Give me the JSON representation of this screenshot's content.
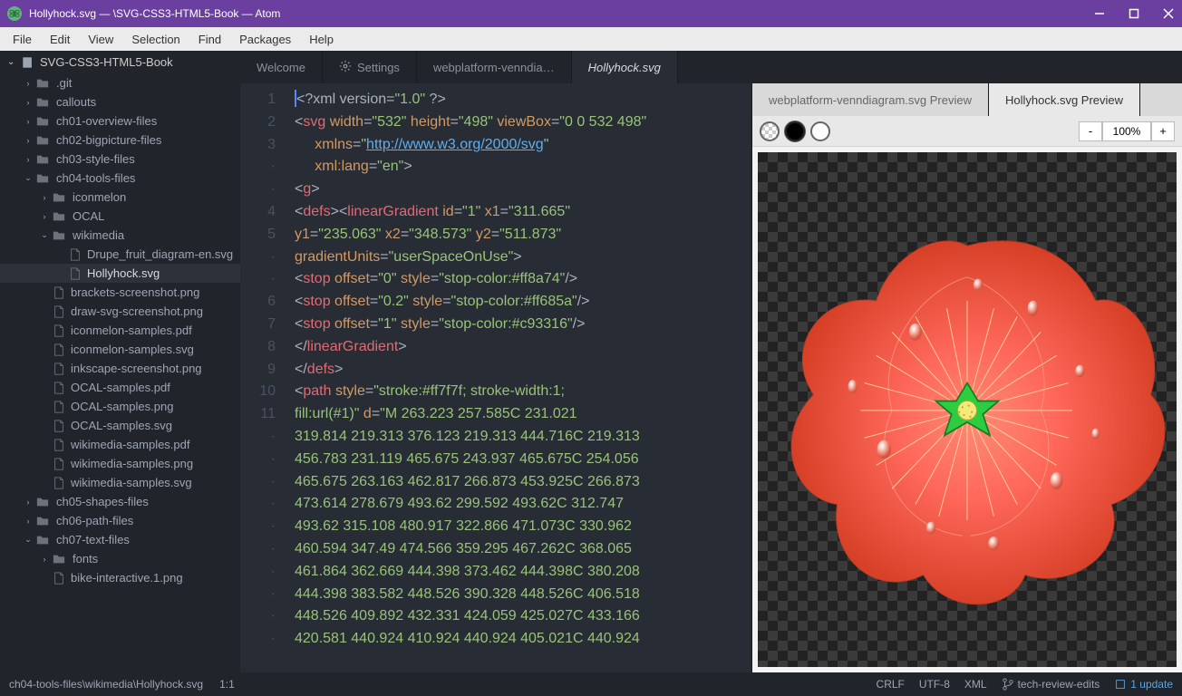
{
  "window": {
    "title": "Hollyhock.svg —                                                             \\SVG-CSS3-HTML5-Book — Atom"
  },
  "menu": [
    "File",
    "Edit",
    "View",
    "Selection",
    "Find",
    "Packages",
    "Help"
  ],
  "tree": {
    "root": "SVG-CSS3-HTML5-Book",
    "items": [
      {
        "indent": 1,
        "chev": "›",
        "type": "folder",
        "label": ".git"
      },
      {
        "indent": 1,
        "chev": "›",
        "type": "folder",
        "label": "callouts"
      },
      {
        "indent": 1,
        "chev": "›",
        "type": "folder",
        "label": "ch01-overview-files"
      },
      {
        "indent": 1,
        "chev": "›",
        "type": "folder",
        "label": "ch02-bigpicture-files"
      },
      {
        "indent": 1,
        "chev": "›",
        "type": "folder",
        "label": "ch03-style-files"
      },
      {
        "indent": 1,
        "chev": "⌄",
        "type": "folder",
        "label": "ch04-tools-files"
      },
      {
        "indent": 2,
        "chev": "›",
        "type": "folder",
        "label": "iconmelon"
      },
      {
        "indent": 2,
        "chev": "›",
        "type": "folder",
        "label": "OCAL"
      },
      {
        "indent": 2,
        "chev": "⌄",
        "type": "folder",
        "label": "wikimedia"
      },
      {
        "indent": 3,
        "chev": "",
        "type": "file",
        "label": "Drupe_fruit_diagram-en.svg"
      },
      {
        "indent": 3,
        "chev": "",
        "type": "file",
        "label": "Hollyhock.svg",
        "selected": true
      },
      {
        "indent": 2,
        "chev": "",
        "type": "file",
        "label": "brackets-screenshot.png"
      },
      {
        "indent": 2,
        "chev": "",
        "type": "file",
        "label": "draw-svg-screenshot.png"
      },
      {
        "indent": 2,
        "chev": "",
        "type": "file",
        "label": "iconmelon-samples.pdf"
      },
      {
        "indent": 2,
        "chev": "",
        "type": "file",
        "label": "iconmelon-samples.svg"
      },
      {
        "indent": 2,
        "chev": "",
        "type": "file",
        "label": "inkscape-screenshot.png"
      },
      {
        "indent": 2,
        "chev": "",
        "type": "file",
        "label": "OCAL-samples.pdf"
      },
      {
        "indent": 2,
        "chev": "",
        "type": "file",
        "label": "OCAL-samples.png"
      },
      {
        "indent": 2,
        "chev": "",
        "type": "file",
        "label": "OCAL-samples.svg"
      },
      {
        "indent": 2,
        "chev": "",
        "type": "file",
        "label": "wikimedia-samples.pdf"
      },
      {
        "indent": 2,
        "chev": "",
        "type": "file",
        "label": "wikimedia-samples.png"
      },
      {
        "indent": 2,
        "chev": "",
        "type": "file",
        "label": "wikimedia-samples.svg"
      },
      {
        "indent": 1,
        "chev": "›",
        "type": "folder",
        "label": "ch05-shapes-files"
      },
      {
        "indent": 1,
        "chev": "›",
        "type": "folder",
        "label": "ch06-path-files"
      },
      {
        "indent": 1,
        "chev": "⌄",
        "type": "folder",
        "label": "ch07-text-files"
      },
      {
        "indent": 2,
        "chev": "›",
        "type": "folder",
        "label": "fonts"
      },
      {
        "indent": 2,
        "chev": "",
        "type": "file",
        "label": "bike-interactive.1.png"
      }
    ]
  },
  "tabs": [
    {
      "label": "Welcome",
      "active": false,
      "icon": ""
    },
    {
      "label": "Settings",
      "active": false,
      "icon": "gear"
    },
    {
      "label": "webplatform-venndia…",
      "active": false,
      "icon": ""
    },
    {
      "label": "Hollyhock.svg",
      "active": true,
      "italic": true,
      "icon": ""
    },
    {
      "label": "webplatform-venndiagram.svg Preview",
      "active": false,
      "icon": "",
      "pane": "right"
    },
    {
      "label": "Hollyhock.svg Preview",
      "active": false,
      "preview_active": true,
      "icon": "",
      "pane": "right"
    }
  ],
  "gutter": [
    "1",
    "2",
    "3",
    "·",
    "·",
    "4",
    "5",
    "·",
    "·",
    "6",
    "7",
    "8",
    "9",
    "10",
    "11",
    "·",
    "·",
    "·",
    "·",
    "·",
    "·",
    "·",
    "·",
    "·",
    "·"
  ],
  "code_lines": [
    [
      {
        "c": "tok-punc",
        "t": "<?"
      },
      {
        "c": "tok-pi",
        "t": "xml version"
      },
      {
        "c": "tok-punc",
        "t": "="
      },
      {
        "c": "tok-str",
        "t": "\"1.0\""
      },
      {
        "c": "tok-punc",
        "t": " ?>"
      }
    ],
    [
      {
        "c": "tok-punc",
        "t": "<"
      },
      {
        "c": "tok-tag",
        "t": "svg"
      },
      {
        "c": "",
        "t": " "
      },
      {
        "c": "tok-attr",
        "t": "width"
      },
      {
        "c": "tok-punc",
        "t": "="
      },
      {
        "c": "tok-str",
        "t": "\"532\""
      },
      {
        "c": "",
        "t": " "
      },
      {
        "c": "tok-attr",
        "t": "height"
      },
      {
        "c": "tok-punc",
        "t": "="
      },
      {
        "c": "tok-str",
        "t": "\"498\""
      },
      {
        "c": "",
        "t": " "
      },
      {
        "c": "tok-attr",
        "t": "viewBox"
      },
      {
        "c": "tok-punc",
        "t": "="
      },
      {
        "c": "tok-str",
        "t": "\"0 0 532 498\""
      }
    ],
    [
      {
        "c": "",
        "t": "     "
      },
      {
        "c": "tok-attr",
        "t": "xmlns"
      },
      {
        "c": "tok-punc",
        "t": "="
      },
      {
        "c": "tok-str",
        "t": "\""
      },
      {
        "c": "tok-url",
        "t": "http://www.w3.org/2000/svg"
      },
      {
        "c": "tok-str",
        "t": "\""
      }
    ],
    [
      {
        "c": "",
        "t": "     "
      },
      {
        "c": "tok-attr",
        "t": "xml:lang"
      },
      {
        "c": "tok-punc",
        "t": "="
      },
      {
        "c": "tok-str",
        "t": "\"en\""
      },
      {
        "c": "tok-punc",
        "t": ">"
      }
    ],
    [
      {
        "c": "tok-punc",
        "t": "<"
      },
      {
        "c": "tok-tag",
        "t": "g"
      },
      {
        "c": "tok-punc",
        "t": ">"
      }
    ],
    [
      {
        "c": "tok-punc",
        "t": "<"
      },
      {
        "c": "tok-tag",
        "t": "defs"
      },
      {
        "c": "tok-punc",
        "t": "><"
      },
      {
        "c": "tok-tag",
        "t": "linearGradient"
      },
      {
        "c": "",
        "t": " "
      },
      {
        "c": "tok-attr",
        "t": "id"
      },
      {
        "c": "tok-punc",
        "t": "="
      },
      {
        "c": "tok-str",
        "t": "\"1\""
      },
      {
        "c": "",
        "t": " "
      },
      {
        "c": "tok-attr",
        "t": "x1"
      },
      {
        "c": "tok-punc",
        "t": "="
      },
      {
        "c": "tok-str",
        "t": "\"311.665\""
      }
    ],
    [
      {
        "c": "tok-attr",
        "t": "y1"
      },
      {
        "c": "tok-punc",
        "t": "="
      },
      {
        "c": "tok-str",
        "t": "\"235.063\""
      },
      {
        "c": "",
        "t": " "
      },
      {
        "c": "tok-attr",
        "t": "x2"
      },
      {
        "c": "tok-punc",
        "t": "="
      },
      {
        "c": "tok-str",
        "t": "\"348.573\""
      },
      {
        "c": "",
        "t": " "
      },
      {
        "c": "tok-attr",
        "t": "y2"
      },
      {
        "c": "tok-punc",
        "t": "="
      },
      {
        "c": "tok-str",
        "t": "\"511.873\""
      }
    ],
    [
      {
        "c": "tok-attr",
        "t": "gradientUnits"
      },
      {
        "c": "tok-punc",
        "t": "="
      },
      {
        "c": "tok-str",
        "t": "\"userSpaceOnUse\""
      },
      {
        "c": "tok-punc",
        "t": ">"
      }
    ],
    [
      {
        "c": "tok-punc",
        "t": "<"
      },
      {
        "c": "tok-tag",
        "t": "stop"
      },
      {
        "c": "",
        "t": " "
      },
      {
        "c": "tok-attr",
        "t": "offset"
      },
      {
        "c": "tok-punc",
        "t": "="
      },
      {
        "c": "tok-str",
        "t": "\"0\""
      },
      {
        "c": "",
        "t": " "
      },
      {
        "c": "tok-attr",
        "t": "style"
      },
      {
        "c": "tok-punc",
        "t": "="
      },
      {
        "c": "tok-str",
        "t": "\"stop-color:#ff8a74\""
      },
      {
        "c": "tok-punc",
        "t": "/>"
      }
    ],
    [
      {
        "c": "tok-punc",
        "t": "<"
      },
      {
        "c": "tok-tag",
        "t": "stop"
      },
      {
        "c": "",
        "t": " "
      },
      {
        "c": "tok-attr",
        "t": "offset"
      },
      {
        "c": "tok-punc",
        "t": "="
      },
      {
        "c": "tok-str",
        "t": "\"0.2\""
      },
      {
        "c": "",
        "t": " "
      },
      {
        "c": "tok-attr",
        "t": "style"
      },
      {
        "c": "tok-punc",
        "t": "="
      },
      {
        "c": "tok-str",
        "t": "\"stop-color:#ff685a\""
      },
      {
        "c": "tok-punc",
        "t": "/>"
      }
    ],
    [
      {
        "c": "tok-punc",
        "t": "<"
      },
      {
        "c": "tok-tag",
        "t": "stop"
      },
      {
        "c": "",
        "t": " "
      },
      {
        "c": "tok-attr",
        "t": "offset"
      },
      {
        "c": "tok-punc",
        "t": "="
      },
      {
        "c": "tok-str",
        "t": "\"1\""
      },
      {
        "c": "",
        "t": " "
      },
      {
        "c": "tok-attr",
        "t": "style"
      },
      {
        "c": "tok-punc",
        "t": "="
      },
      {
        "c": "tok-str",
        "t": "\"stop-color:#c93316\""
      },
      {
        "c": "tok-punc",
        "t": "/>"
      }
    ],
    [
      {
        "c": "tok-punc",
        "t": "</"
      },
      {
        "c": "tok-tag",
        "t": "linearGradient"
      },
      {
        "c": "tok-punc",
        "t": ">"
      }
    ],
    [
      {
        "c": "tok-punc",
        "t": "</"
      },
      {
        "c": "tok-tag",
        "t": "defs"
      },
      {
        "c": "tok-punc",
        "t": ">"
      }
    ],
    [
      {
        "c": "tok-punc",
        "t": "<"
      },
      {
        "c": "tok-tag",
        "t": "path"
      },
      {
        "c": "",
        "t": " "
      },
      {
        "c": "tok-attr",
        "t": "style"
      },
      {
        "c": "tok-punc",
        "t": "="
      },
      {
        "c": "tok-str",
        "t": "\"stroke:#ff7f7f; stroke-width:1;"
      }
    ],
    [
      {
        "c": "tok-str",
        "t": "fill:url(#1)\""
      },
      {
        "c": "",
        "t": " "
      },
      {
        "c": "tok-attr",
        "t": "d"
      },
      {
        "c": "tok-punc",
        "t": "="
      },
      {
        "c": "tok-str",
        "t": "\"M 263.223 257.585C 231.021"
      }
    ],
    [
      {
        "c": "tok-num",
        "t": "319.814 219.313 376.123 219.313 444.716C 219.313"
      }
    ],
    [
      {
        "c": "tok-num",
        "t": "456.783 231.119 465.675 243.937 465.675C 254.056"
      }
    ],
    [
      {
        "c": "tok-num",
        "t": "465.675 263.163 462.817 266.873 453.925C 266.873"
      }
    ],
    [
      {
        "c": "tok-num",
        "t": "473.614 278.679 493.62 299.592 493.62C 312.747"
      }
    ],
    [
      {
        "c": "tok-num",
        "t": "493.62 315.108 480.917 322.866 471.073C 330.962"
      }
    ],
    [
      {
        "c": "tok-num",
        "t": "460.594 347.49 474.566 359.295 467.262C 368.065"
      }
    ],
    [
      {
        "c": "tok-num",
        "t": "461.864 362.669 444.398 373.462 444.398C 380.208"
      }
    ],
    [
      {
        "c": "tok-num",
        "t": "444.398 383.582 448.526 390.328 448.526C 406.518"
      }
    ],
    [
      {
        "c": "tok-num",
        "t": "448.526 409.892 432.331 424.059 425.027C 433.166"
      }
    ],
    [
      {
        "c": "tok-num",
        "t": "420.581 440.924 410.924 440.924 405.021C 440.924"
      }
    ]
  ],
  "preview": {
    "zoom_minus": "-",
    "zoom_value": "100%",
    "zoom_plus": "+"
  },
  "status": {
    "path": "ch04-tools-files\\wikimedia\\Hollyhock.svg",
    "pos": "1:1",
    "eol": "CRLF",
    "enc": "UTF-8",
    "lang": "XML",
    "branch": "tech-review-edits",
    "updates": "1 update"
  }
}
